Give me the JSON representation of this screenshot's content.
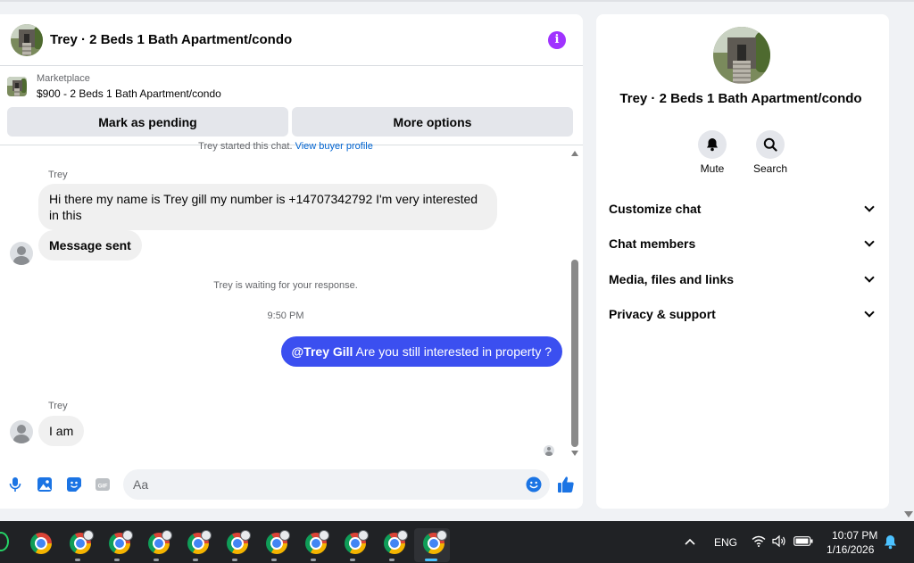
{
  "header": {
    "title": "Trey · 2 Beds 1 Bath Apartment/condo"
  },
  "listing": {
    "source_label": "Marketplace",
    "price_title": "$900 - 2 Beds 1 Bath Apartment/condo"
  },
  "actions": {
    "pending_label": "Mark as pending",
    "more_label": "More options"
  },
  "thread": {
    "start_text": "Trey started this chat.",
    "profile_link": "View buyer profile",
    "sender_name_1": "Trey",
    "message_1": "Hi there my name is Trey gill my number is +14707342792 I'm very interested in this",
    "message_2": "Message sent",
    "waiting_text": "Trey is waiting for your response.",
    "timestamp": "9:50 PM",
    "my_mention": "@Trey Gill",
    "my_message": " Are you still interested in property ?",
    "sender_name_2": "Trey",
    "message_3": "I am"
  },
  "composer": {
    "placeholder": "Aa"
  },
  "info_panel": {
    "name": "Trey · 2 Beds 1 Bath Apartment/condo",
    "mute_label": "Mute",
    "search_label": "Search",
    "sections": [
      "Customize chat",
      "Chat members",
      "Media, files and links",
      "Privacy & support"
    ]
  },
  "taskbar": {
    "language": "ENG",
    "time": "10:07 PM",
    "date": "1/16/2026"
  },
  "colors": {
    "accent_purple": "#a033ff",
    "my_bubble": "#3b4ff0",
    "link": "#0064d1"
  }
}
